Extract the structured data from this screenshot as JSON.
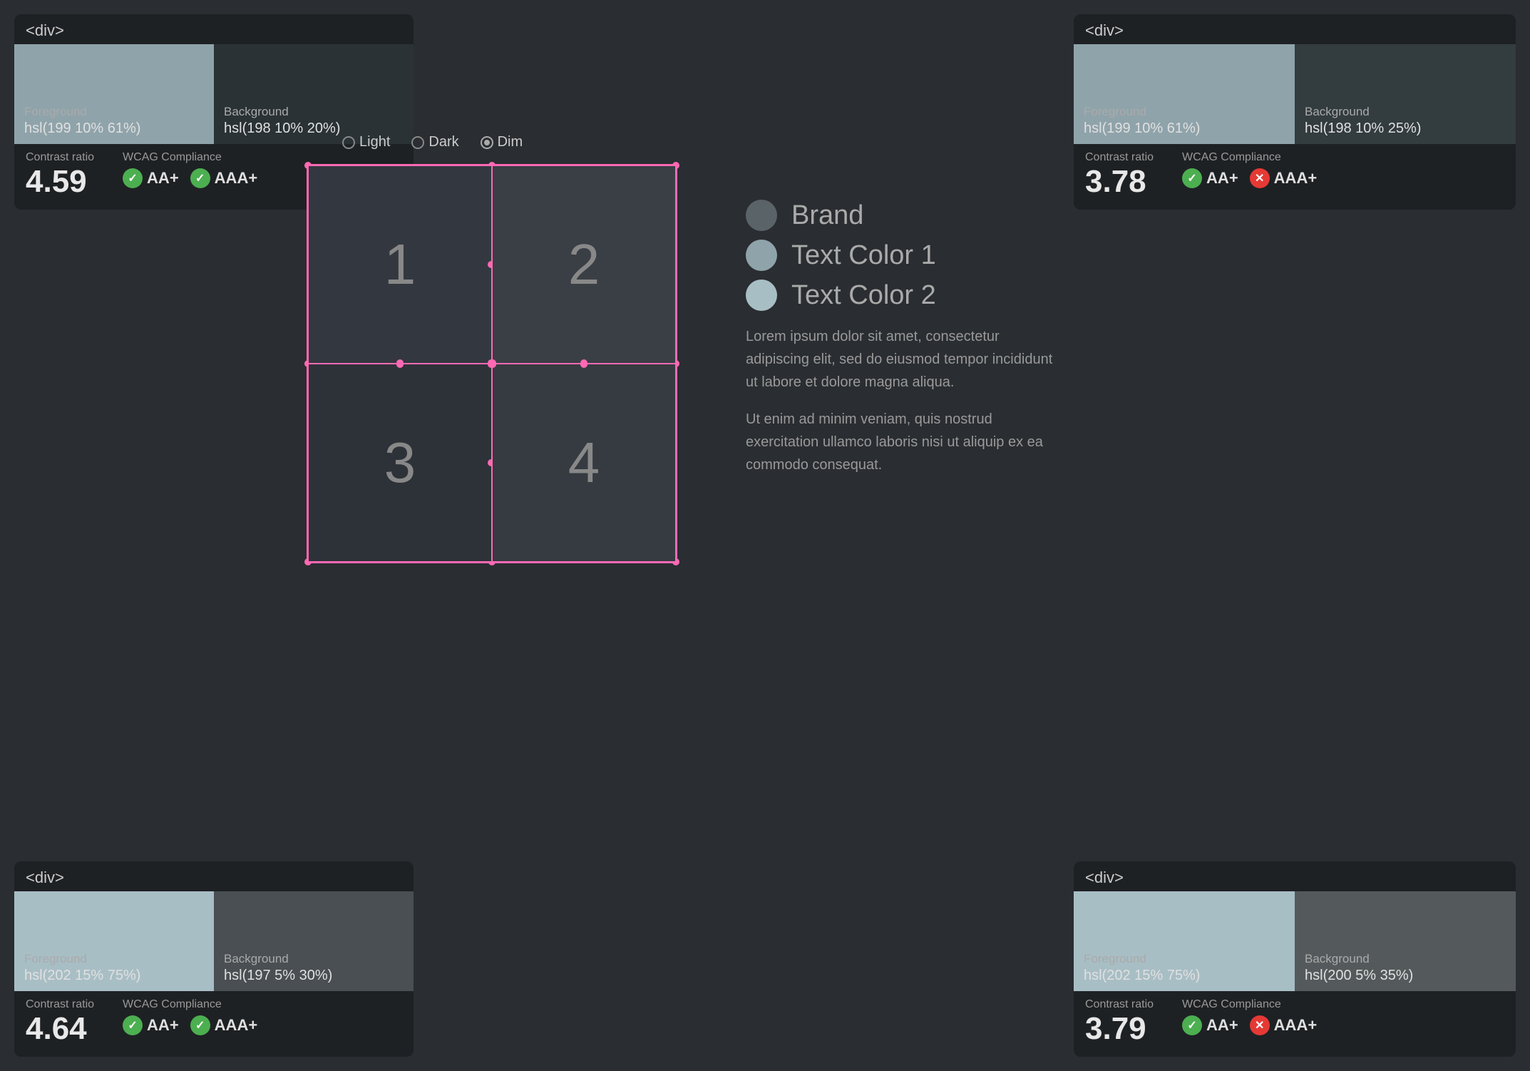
{
  "cards": {
    "top_left": {
      "tag": "<div>",
      "foreground_label": "Foreground",
      "foreground_value": "hsl(199 10% 61%)",
      "background_label": "Background",
      "background_value": "hsl(198 10% 20%)",
      "foreground_color": "#8fa3aa",
      "background_color": "#2a3235",
      "contrast_label": "Contrast ratio",
      "contrast_value": "4.59",
      "wcag_label": "WCAG Compliance",
      "badge_aa": "AA+",
      "badge_aaa": "AAA+",
      "aa_pass": true,
      "aaa_pass": true
    },
    "top_right": {
      "tag": "<div>",
      "foreground_label": "Foreground",
      "foreground_value": "hsl(199 10% 61%)",
      "background_label": "Background",
      "background_value": "hsl(198 10% 25%)",
      "foreground_color": "#8fa3aa",
      "background_color": "#333c3f",
      "contrast_label": "Contrast ratio",
      "contrast_value": "3.78",
      "wcag_label": "WCAG Compliance",
      "badge_aa": "AA+",
      "badge_aaa": "AAA+",
      "aa_pass": true,
      "aaa_pass": false
    },
    "bottom_left": {
      "tag": "<div>",
      "foreground_label": "Foreground",
      "foreground_value": "hsl(202 15% 75%)",
      "background_label": "Background",
      "background_value": "hsl(197 5% 30%)",
      "foreground_color": "#a8bec5",
      "background_color": "#494f52",
      "contrast_label": "Contrast ratio",
      "contrast_value": "4.64",
      "wcag_label": "WCAG Compliance",
      "badge_aa": "AA+",
      "badge_aaa": "AAA+",
      "aa_pass": true,
      "aaa_pass": true
    },
    "bottom_right": {
      "tag": "<div>",
      "foreground_label": "Foreground",
      "foreground_value": "hsl(202 15% 75%)",
      "background_label": "Background",
      "background_value": "hsl(200 5% 35%)",
      "foreground_color": "#a8bec5",
      "background_color": "#545a5c",
      "contrast_label": "Contrast ratio",
      "contrast_value": "3.79",
      "wcag_label": "WCAG Compliance",
      "badge_aa": "AA+",
      "badge_aaa": "AAA+",
      "aa_pass": true,
      "aaa_pass": false
    }
  },
  "theme": {
    "options": [
      "Light",
      "Dark",
      "Dim"
    ],
    "selected": "Dim"
  },
  "grid": {
    "cells": [
      "1",
      "2",
      "3",
      "4"
    ]
  },
  "legend": {
    "items": [
      {
        "label": "Brand",
        "color": "#5a6368"
      },
      {
        "label": "Text Color 1",
        "color": "#8fa3aa"
      },
      {
        "label": "Text Color 2",
        "color": "#a8bec5"
      }
    ]
  },
  "description": {
    "para1": "Lorem ipsum dolor sit amet, consectetur adipiscing elit, sed do eiusmod tempor incididunt ut labore et dolore magna aliqua.",
    "para2": "Ut enim ad minim veniam, quis nostrud exercitation ullamco laboris nisi ut aliquip ex ea commodo consequat."
  }
}
